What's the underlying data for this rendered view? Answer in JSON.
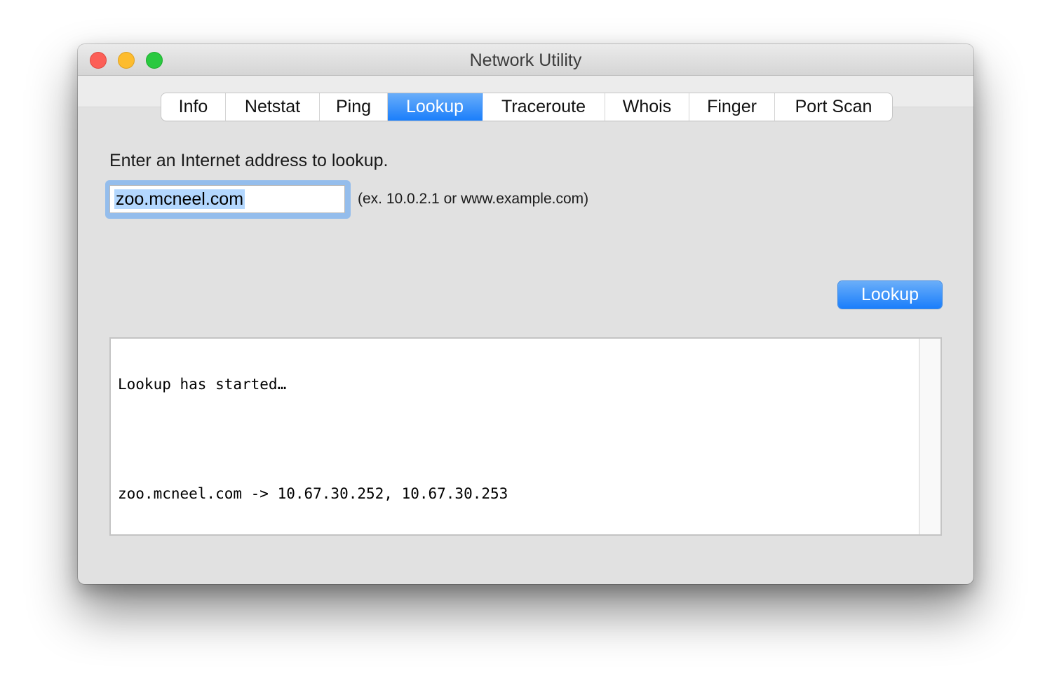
{
  "window": {
    "title": "Network Utility",
    "controls": [
      "close",
      "minimize",
      "zoom"
    ]
  },
  "tabs": [
    {
      "label": "Info",
      "active": false
    },
    {
      "label": "Netstat",
      "active": false
    },
    {
      "label": "Ping",
      "active": false
    },
    {
      "label": "Lookup",
      "active": true
    },
    {
      "label": "Traceroute",
      "active": false
    },
    {
      "label": "Whois",
      "active": false
    },
    {
      "label": "Finger",
      "active": false
    },
    {
      "label": "Port Scan",
      "active": false
    }
  ],
  "lookup": {
    "prompt": "Enter an Internet address to lookup.",
    "address_value": "zoo.mcneel.com",
    "hint": "(ex. 10.0.2.1 or www.example.com)",
    "button_label": "Lookup"
  },
  "output": {
    "lines": [
      "Lookup has started…",
      "",
      "zoo.mcneel.com -> 10.67.30.252, 10.67.30.253"
    ]
  },
  "colors": {
    "accent": "#1a7efb",
    "selection": "#b3d7fe",
    "focus_ring": "#94bdec"
  }
}
